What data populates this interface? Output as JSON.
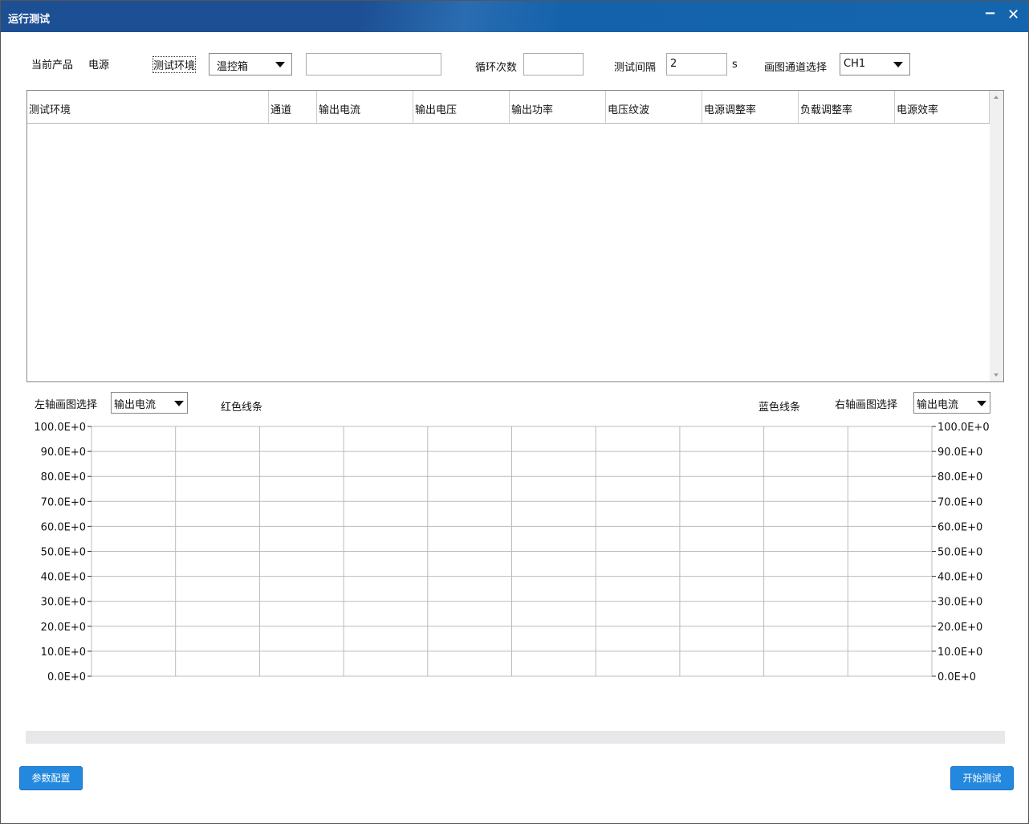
{
  "window": {
    "title": "运行测试",
    "minimize_icon": "minimize-icon",
    "close_icon": "close-icon"
  },
  "toolbar": {
    "current_product_label": "当前产品",
    "current_product_value": "电源",
    "test_env_label": "测试环境",
    "test_env_value": "温控箱",
    "test_env_extra": "",
    "cycles_label": "循环次数",
    "cycles_value": "",
    "interval_label": "测试间隔",
    "interval_value": "2",
    "interval_unit": "s",
    "channel_label": "画图通道选择",
    "channel_value": "CH1"
  },
  "table": {
    "columns": [
      "测试环境",
      "通道",
      "输出电流",
      "输出电压",
      "输出功率",
      "电压纹波",
      "电源调整率",
      "负载调整率",
      "电源效率"
    ],
    "rows": []
  },
  "chart_controls": {
    "left_label": "左轴画图选择",
    "left_value": "输出电流",
    "left_line": "红色线条",
    "right_line": "蓝色线条",
    "right_label": "右轴画图选择",
    "right_value": "输出电流"
  },
  "chart_data": {
    "type": "line",
    "series": [
      {
        "name": "红色线条",
        "color": "#ff0000",
        "axis": "left",
        "values": []
      },
      {
        "name": "蓝色线条",
        "color": "#0000ff",
        "axis": "right",
        "values": []
      }
    ],
    "ylim": [
      0,
      100
    ],
    "left_ticks": [
      "0.0E+0",
      "10.0E+0",
      "20.0E+0",
      "30.0E+0",
      "40.0E+0",
      "50.0E+0",
      "60.0E+0",
      "70.0E+0",
      "80.0E+0",
      "90.0E+0",
      "100.0E+0"
    ],
    "right_ticks": [
      "0.0E+0",
      "10.0E+0",
      "20.0E+0",
      "30.0E+0",
      "40.0E+0",
      "50.0E+0",
      "60.0E+0",
      "70.0E+0",
      "80.0E+0",
      "90.0E+0",
      "100.0E+0"
    ],
    "vertical_gridlines": 10,
    "grid": true
  },
  "progress": {
    "value": 0
  },
  "buttons": {
    "config": "参数配置",
    "start": "开始测试"
  }
}
